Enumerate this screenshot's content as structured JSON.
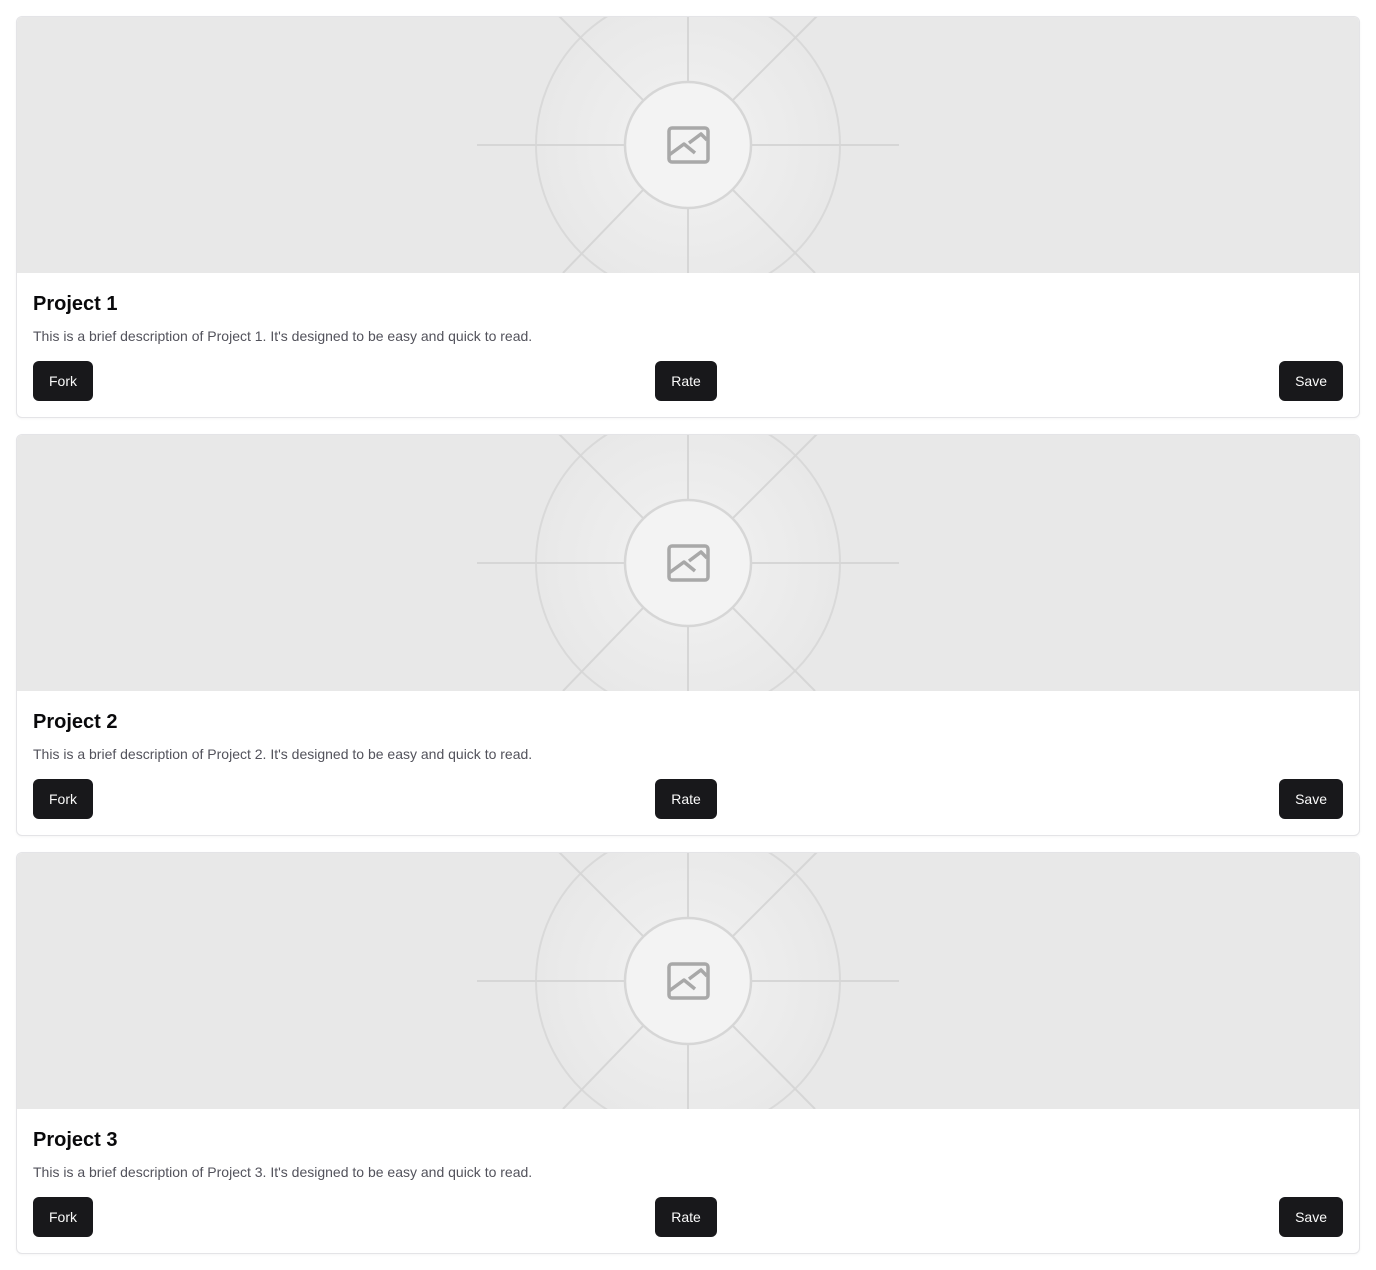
{
  "projects": [
    {
      "title": "Project 1",
      "description": "This is a brief description of Project 1. It's designed to be easy and quick to read.",
      "image_icon": "image-placeholder-icon",
      "actions": [
        "Fork",
        "Rate",
        "Save"
      ]
    },
    {
      "title": "Project 2",
      "description": "This is a brief description of Project 2. It's designed to be easy and quick to read.",
      "image_icon": "image-placeholder-icon",
      "actions": [
        "Fork",
        "Rate",
        "Save"
      ]
    },
    {
      "title": "Project 3",
      "description": "This is a brief description of Project 3. It's designed to be easy and quick to read.",
      "image_icon": "image-placeholder-icon",
      "actions": [
        "Fork",
        "Rate",
        "Save"
      ]
    }
  ],
  "colors": {
    "button_bg": "#18181b",
    "button_text": "#fafafa",
    "title": "#09090b",
    "description": "#52525b",
    "image_bg": "#e8e8e8",
    "card_border": "#e4e4e7"
  }
}
